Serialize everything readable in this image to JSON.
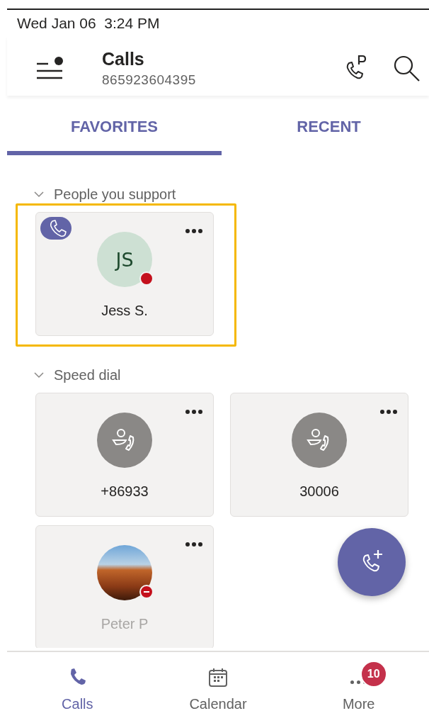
{
  "status_bar": {
    "datetime": "Wed Jan 06  3:24 PM"
  },
  "header": {
    "title": "Calls",
    "subtitle": "865923604395",
    "menu_notification": true
  },
  "tabs": [
    {
      "label": "FAVORITES",
      "selected": true
    },
    {
      "label": "RECENT",
      "selected": false
    }
  ],
  "sections": [
    {
      "title": "People you support",
      "expanded": true,
      "cards": [
        {
          "kind": "person",
          "name": "Jess S.",
          "initials": "JS",
          "highlighted": true,
          "call_badge": true,
          "presence": {
            "kind": "busy",
            "color": "#c4101c"
          }
        }
      ]
    },
    {
      "title": "Speed dial",
      "expanded": true,
      "cards": [
        {
          "kind": "number",
          "name": "+86933",
          "highlighted": false,
          "call_badge": false
        },
        {
          "kind": "number",
          "name": "30006",
          "highlighted": false,
          "call_badge": false
        },
        {
          "kind": "photo",
          "name": "Peter P",
          "highlighted": false,
          "call_badge": false,
          "presence": {
            "kind": "dnd",
            "color": "#c4101c"
          }
        }
      ]
    }
  ],
  "nav": [
    {
      "label": "Calls",
      "selected": true
    },
    {
      "label": "Calendar",
      "selected": false
    },
    {
      "label": "More",
      "selected": false,
      "badge": "10"
    }
  ]
}
